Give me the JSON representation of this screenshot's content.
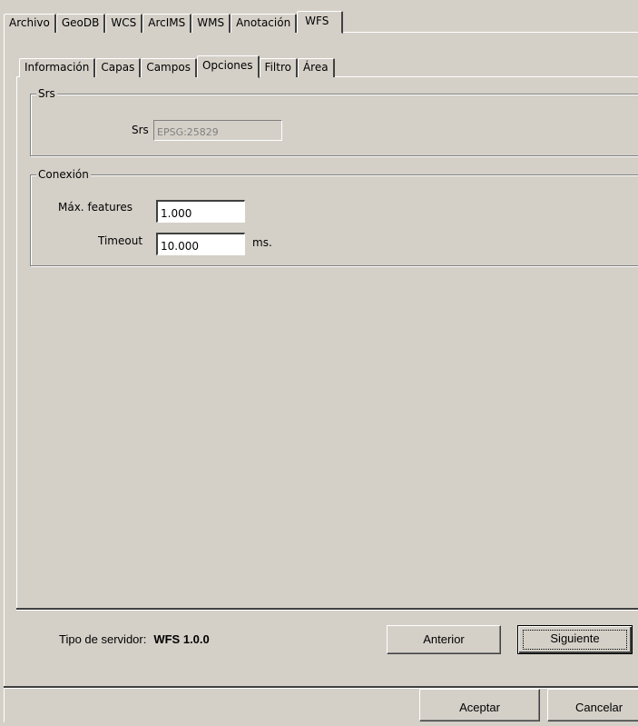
{
  "main_tabs": [
    {
      "label": "Archivo",
      "active": false
    },
    {
      "label": "GeoDB",
      "active": false
    },
    {
      "label": "WCS",
      "active": false
    },
    {
      "label": "ArcIMS",
      "active": false
    },
    {
      "label": "WMS",
      "active": false
    },
    {
      "label": "Anotación",
      "active": false
    },
    {
      "label": "WFS",
      "active": true
    }
  ],
  "sub_tabs": [
    {
      "label": "Información",
      "active": false
    },
    {
      "label": "Capas",
      "active": false
    },
    {
      "label": "Campos",
      "active": false
    },
    {
      "label": "Opciones",
      "active": true
    },
    {
      "label": "Filtro",
      "active": false
    },
    {
      "label": "Área",
      "active": false
    }
  ],
  "srs_group": {
    "legend": "Srs",
    "srs_label": "Srs",
    "srs_value": "EPSG:25829"
  },
  "conexion_group": {
    "legend": "Conexión",
    "max_features_label": "Máx. features",
    "max_features_value": "1.000",
    "timeout_label": "Timeout",
    "timeout_value": "10.000",
    "timeout_unit": "ms."
  },
  "footer": {
    "server_type_label": "Tipo de servidor:",
    "server_type_value": "WFS 1.0.0",
    "previous_label": "Anterior",
    "next_label": "Siguiente"
  },
  "dialog_buttons": {
    "accept_label": "Aceptar",
    "cancel_label": "Cancelar"
  }
}
